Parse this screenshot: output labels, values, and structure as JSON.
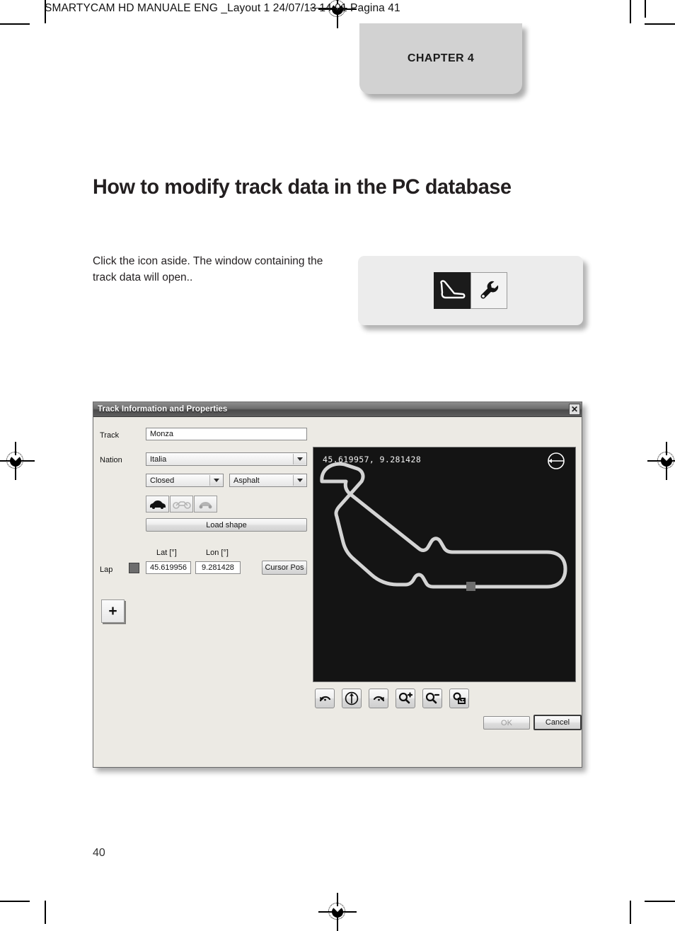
{
  "header": {
    "slug_before": "SMARTYCAM HD MANUALE ENG _Layout 1  24/07/1",
    "slug_struck": "3  14.01",
    "slug_after": "  Pagina 41"
  },
  "chapter_tab": {
    "label": "CHAPTER 4"
  },
  "title": "How to modify track data in the PC database",
  "body": "Click the icon aside. The window containing the track data will open..",
  "icon_panel": {
    "track_icon_name": "track-shape-icon",
    "wrench_icon_name": "wrench-icon"
  },
  "dialog": {
    "title": "Track Information and Properties",
    "close_label": "✕",
    "fields": {
      "track_label": "Track",
      "track_value": "Monza",
      "nation_label": "Nation",
      "nation_value": "Italia",
      "layout_value": "Closed",
      "surface_value": "Asphalt"
    },
    "vehicles": [
      {
        "name": "car-icon",
        "state": "selected"
      },
      {
        "name": "motorcycle-icon",
        "state": "disabled"
      },
      {
        "name": "scooter-icon",
        "state": "disabled"
      }
    ],
    "load_shape_label": "Load shape",
    "coords": {
      "lat_header": "Lat [°]",
      "lon_header": "Lon [°]",
      "row_label": "Lap",
      "lat_value": "45.619956",
      "lon_value": "9.281428",
      "cursor_pos_label": "Cursor Pos"
    },
    "add_button_label": "+",
    "map": {
      "coords_overlay": "45.619957, 9.281428",
      "compass_icon": "compass-west-icon",
      "background_color": "#141414",
      "track_color": "#d4d4d4",
      "marker_color": "#6d6d6d"
    },
    "map_tools": [
      {
        "name": "rotate-left-icon",
        "label": ""
      },
      {
        "name": "orientation-north-icon",
        "label": ""
      },
      {
        "name": "rotate-right-icon",
        "label": ""
      },
      {
        "name": "zoom-in-icon",
        "label": ""
      },
      {
        "name": "zoom-out-icon",
        "label": ""
      },
      {
        "name": "zoom-fit-icon",
        "label": ""
      }
    ],
    "ok_label": "OK",
    "cancel_label": "Cancel"
  },
  "footer": {
    "page_number": "40"
  }
}
